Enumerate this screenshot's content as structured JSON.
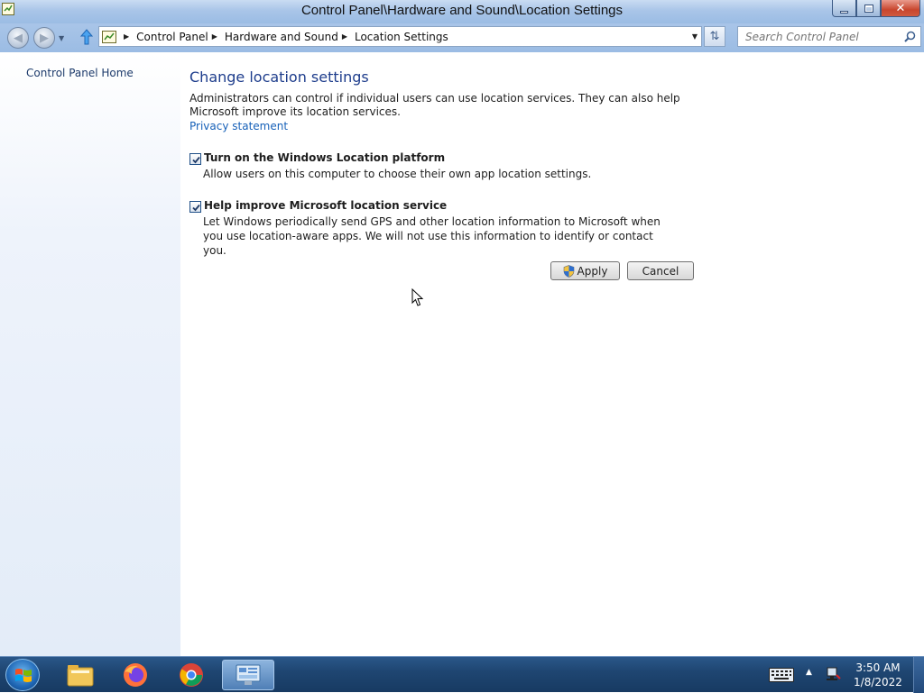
{
  "window": {
    "title": "Control Panel\\Hardware and Sound\\Location Settings",
    "minimize_icon": "minimize-icon",
    "maximize_icon": "restore-icon",
    "close_label": "✕"
  },
  "nav": {
    "breadcrumbs": [
      "Control Panel",
      "Hardware and Sound",
      "Location Settings"
    ],
    "search_placeholder": "Search Control Panel"
  },
  "sidebar": {
    "home_link": "Control Panel Home"
  },
  "main": {
    "title": "Change location settings",
    "description": "Administrators can control if individual users can use location services. They can also help Microsoft improve its location services.",
    "privacy_link": "Privacy statement",
    "options": [
      {
        "label": "Turn on the Windows Location platform",
        "description": "Allow users on this computer to choose their own app location settings.",
        "checked": true
      },
      {
        "label": "Help improve Microsoft location service",
        "description": "Let Windows periodically send GPS and other location information to Microsoft when you use location-aware apps. We will not use this information to identify or contact you.",
        "checked": true
      }
    ],
    "apply_label": "Apply",
    "cancel_label": "Cancel"
  },
  "taskbar": {
    "items": [
      "windows-start-icon",
      "file-explorer-icon",
      "firefox-icon",
      "chrome-icon",
      "control-panel-icon"
    ],
    "clock_time": "3:50 AM",
    "clock_date": "1/8/2022"
  },
  "colors": {
    "title_link": "#1e3d8c",
    "link": "#1660b8",
    "taskbar": "#1f4672"
  }
}
